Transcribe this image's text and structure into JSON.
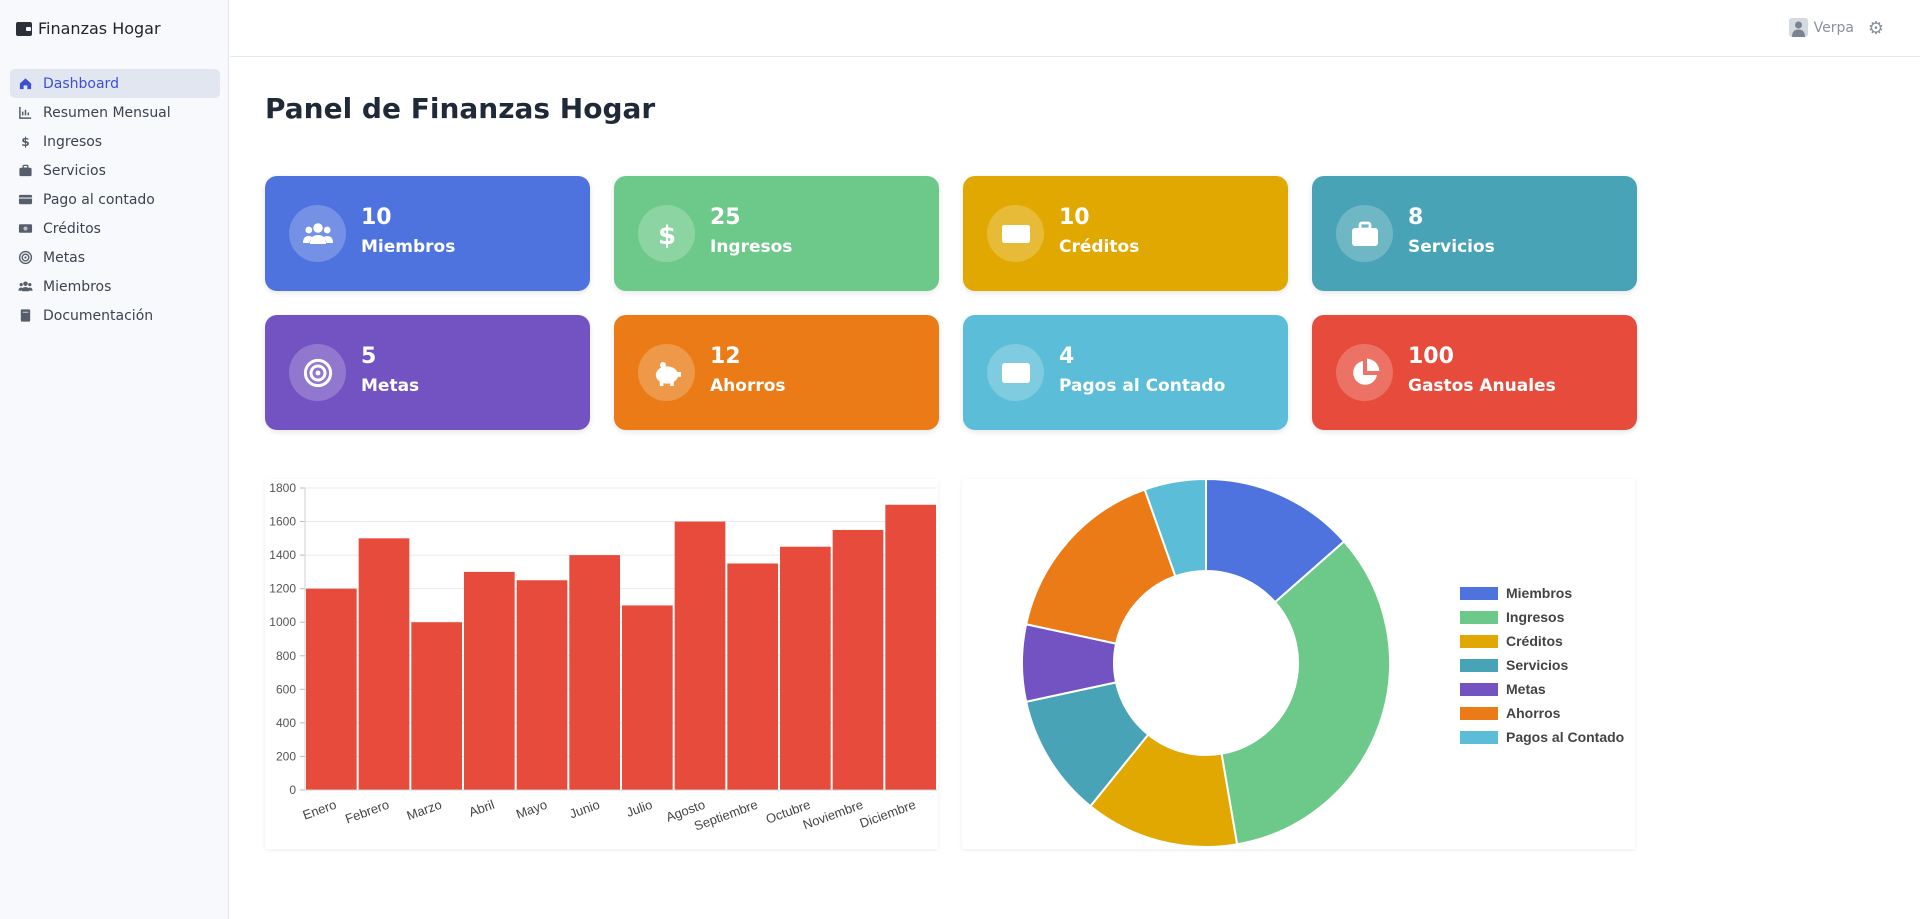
{
  "app": {
    "brand": "Finanzas Hogar",
    "page_title": "Panel de Finanzas Hogar"
  },
  "sidebar": {
    "items": [
      {
        "label": "Dashboard",
        "icon": "home-icon",
        "active": true
      },
      {
        "label": "Resumen Mensual",
        "icon": "chart-line-icon"
      },
      {
        "label": "Ingresos",
        "icon": "dollar-icon"
      },
      {
        "label": "Servicios",
        "icon": "briefcase-icon"
      },
      {
        "label": "Pago al contado",
        "icon": "credit-card-icon"
      },
      {
        "label": "Créditos",
        "icon": "money-bill-icon"
      },
      {
        "label": "Metas",
        "icon": "target-icon"
      },
      {
        "label": "Miembros",
        "icon": "users-icon"
      },
      {
        "label": "Documentación",
        "icon": "book-icon"
      }
    ]
  },
  "header": {
    "user_name": "Verpa",
    "user_icon": "user-icon",
    "settings_icon": "gear-icon"
  },
  "cards": [
    {
      "value": "10",
      "label": "Miembros",
      "color": "#4e73df",
      "icon": "users-icon"
    },
    {
      "value": "25",
      "label": "Ingresos",
      "color": "#6cc98a",
      "icon": "dollar-icon"
    },
    {
      "value": "10",
      "label": "Créditos",
      "color": "#e0a800",
      "icon": "money-bill-icon"
    },
    {
      "value": "8",
      "label": "Servicios",
      "color": "#48a3b6",
      "icon": "briefcase-icon"
    },
    {
      "value": "5",
      "label": "Metas",
      "color": "#7352c1",
      "icon": "target-icon"
    },
    {
      "value": "12",
      "label": "Ahorros",
      "color": "#ea7b16",
      "icon": "piggy-bank-icon"
    },
    {
      "value": "4",
      "label": "Pagos al Contado",
      "color": "#5bbdd7",
      "icon": "credit-card-icon"
    },
    {
      "value": "100",
      "label": "Gastos Anuales",
      "color": "#e74b3c",
      "icon": "pie-chart-icon"
    }
  ],
  "chart_data": [
    {
      "type": "bar",
      "categories": [
        "Enero",
        "Febrero",
        "Marzo",
        "Abril",
        "Mayo",
        "Junio",
        "Julio",
        "Agosto",
        "Septiembre",
        "Octubre",
        "Noviembre",
        "Diciembre"
      ],
      "values": [
        1200,
        1500,
        1000,
        1300,
        1250,
        1400,
        1100,
        1600,
        1350,
        1450,
        1550,
        1700
      ],
      "ylim": [
        0,
        1800
      ],
      "yticks": [
        0,
        200,
        400,
        600,
        800,
        1000,
        1200,
        1400,
        1600,
        1800
      ],
      "color": "#e74b3c",
      "grid": true,
      "legend": "none"
    },
    {
      "type": "pie",
      "donut": true,
      "labels": [
        "Miembros",
        "Ingresos",
        "Créditos",
        "Servicios",
        "Metas",
        "Ahorros",
        "Pagos al Contado"
      ],
      "values": [
        10,
        25,
        10,
        8,
        5,
        12,
        4
      ],
      "colors": [
        "#4e73df",
        "#6cc98a",
        "#e0a800",
        "#48a3b6",
        "#7352c1",
        "#ea7b16",
        "#5bbdd7"
      ],
      "legend": "right"
    }
  ]
}
